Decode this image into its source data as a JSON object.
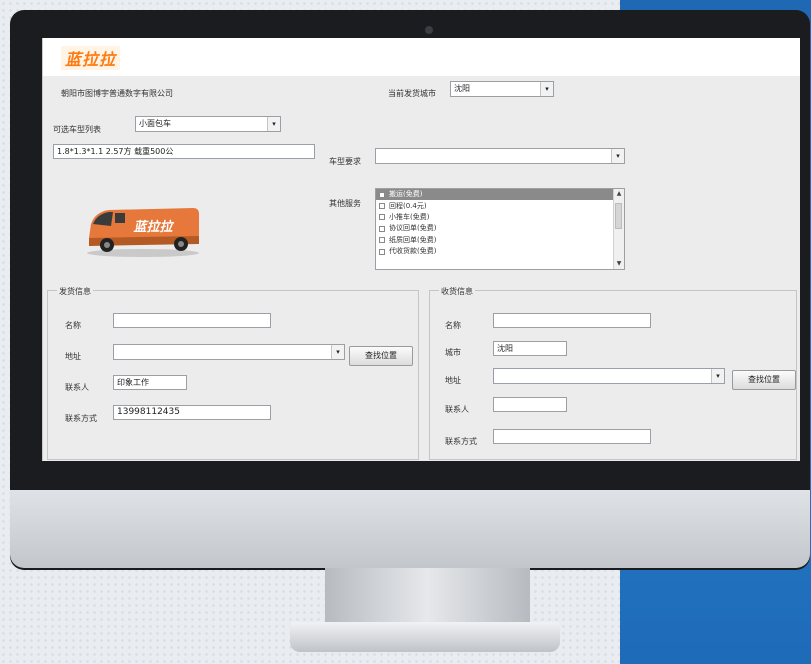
{
  "app": {
    "logo_text": "蓝拉拉",
    "company": "朝阳市图博宇普通数字有限公司"
  },
  "current_city": {
    "label": "当前发货城市",
    "value": "沈阳"
  },
  "vehicle_list": {
    "label": "可选车型列表",
    "value": "小面包车",
    "spec": "1.8*1.3*1.1  2.57方  载重500公"
  },
  "truck_brand": "蓝拉拉",
  "vehicle_req": {
    "label": "车型要求",
    "value": ""
  },
  "other_services": {
    "label": "其他服务",
    "items": [
      {
        "label": "搬运(免费)",
        "selected": true
      },
      {
        "label": "回程(0.4元)",
        "selected": false
      },
      {
        "label": "小推车(免费)",
        "selected": false
      },
      {
        "label": "协议回单(免费)",
        "selected": false
      },
      {
        "label": "纸质回单(免费)",
        "selected": false
      },
      {
        "label": "代收货款(免费)",
        "selected": false
      }
    ]
  },
  "sender": {
    "title": "发货信息",
    "name_label": "名称",
    "name_value": "",
    "address_label": "地址",
    "address_value": "",
    "find_button": "查找位置",
    "contact_label": "联系人",
    "contact_value": "印象工作",
    "phone_label": "联系方式",
    "phone_value": "13998112435"
  },
  "receiver": {
    "title": "收货信息",
    "name_label": "名称",
    "name_value": "",
    "city_label": "城市",
    "city_value": "沈阳",
    "address_label": "地址",
    "address_value": "",
    "find_button": "查找位置",
    "contact_label": "联系人",
    "contact_value": "",
    "phone_label": "联系方式",
    "phone_value": ""
  },
  "colors": {
    "accent": "#ff7a10",
    "truck": "#e5783a",
    "backdrop_blue": "#2479c9"
  }
}
